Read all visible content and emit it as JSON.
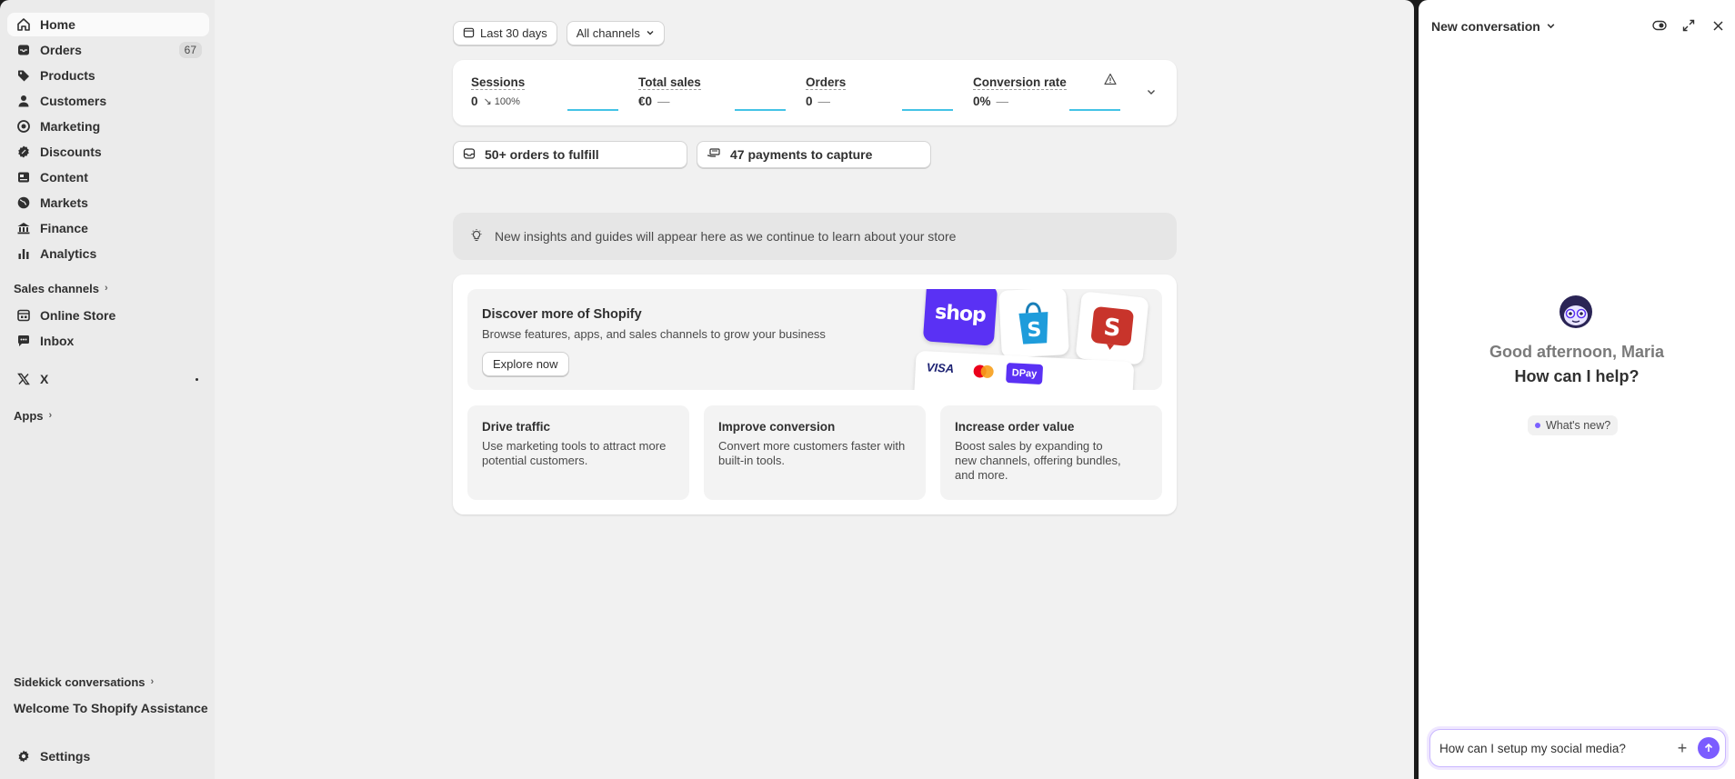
{
  "sidebar": {
    "items": [
      {
        "label": "Home",
        "icon": "home-icon",
        "active": true
      },
      {
        "label": "Orders",
        "icon": "inbox-icon",
        "count": "67"
      },
      {
        "label": "Products",
        "icon": "tag-icon"
      },
      {
        "label": "Customers",
        "icon": "person-icon"
      },
      {
        "label": "Marketing",
        "icon": "target-icon"
      },
      {
        "label": "Discounts",
        "icon": "discount-icon"
      },
      {
        "label": "Content",
        "icon": "content-icon"
      },
      {
        "label": "Markets",
        "icon": "globe-icon"
      },
      {
        "label": "Finance",
        "icon": "bank-icon"
      },
      {
        "label": "Analytics",
        "icon": "bar-chart-icon"
      }
    ],
    "sales_channels_label": "Sales channels",
    "channels": [
      {
        "label": "Online Store",
        "icon": "store-icon"
      },
      {
        "label": "Inbox",
        "icon": "chat-icon"
      }
    ],
    "x_app": {
      "label": "X",
      "icon": "x-logo-icon"
    },
    "apps_label": "Apps",
    "sidekick_label": "Sidekick conversations",
    "welcome_label": "Welcome To Shopify Assistance",
    "settings_label": "Settings"
  },
  "filters": {
    "date": "Last 30 days",
    "channel": "All channels"
  },
  "metrics": [
    {
      "label": "Sessions",
      "value": "0",
      "delta": "100%",
      "delta_icon": "↘"
    },
    {
      "label": "Total sales",
      "value": "€0",
      "delta": "—"
    },
    {
      "label": "Orders",
      "value": "0",
      "delta": "—"
    },
    {
      "label": "Conversion rate",
      "value": "0%",
      "delta": "—"
    }
  ],
  "tasks": {
    "fulfill": "50+ orders to fulfill",
    "capture": "47 payments to capture"
  },
  "insights_text": "New insights and guides will appear here as we continue to learn about your store",
  "discover": {
    "title": "Discover more of Shopify",
    "subtitle": "Browse features, apps, and sales channels to grow your business",
    "button": "Explore now",
    "shop_tile": "shop",
    "visa": "VISA",
    "dpay": "DPay"
  },
  "features": [
    {
      "title": "Drive traffic",
      "desc": "Use marketing tools to attract more potential customers."
    },
    {
      "title": "Improve conversion",
      "desc": "Convert more customers faster with built-in tools."
    },
    {
      "title": "Increase order value",
      "desc": "Boost sales by expanding to new channels, offering bundles, and more."
    }
  ],
  "sidekick": {
    "title": "New conversation",
    "greeting": "Good afternoon, Maria",
    "help": "How can I help?",
    "whats_new": "What's new?",
    "input_value": "How can I setup my social media?",
    "accent": "#7b5cff"
  },
  "colors": {
    "sparkline": "#43c3e6",
    "shop_purple": "#5a31f4",
    "background": "#f1f1f1",
    "sidebar": "#ebebeb"
  }
}
